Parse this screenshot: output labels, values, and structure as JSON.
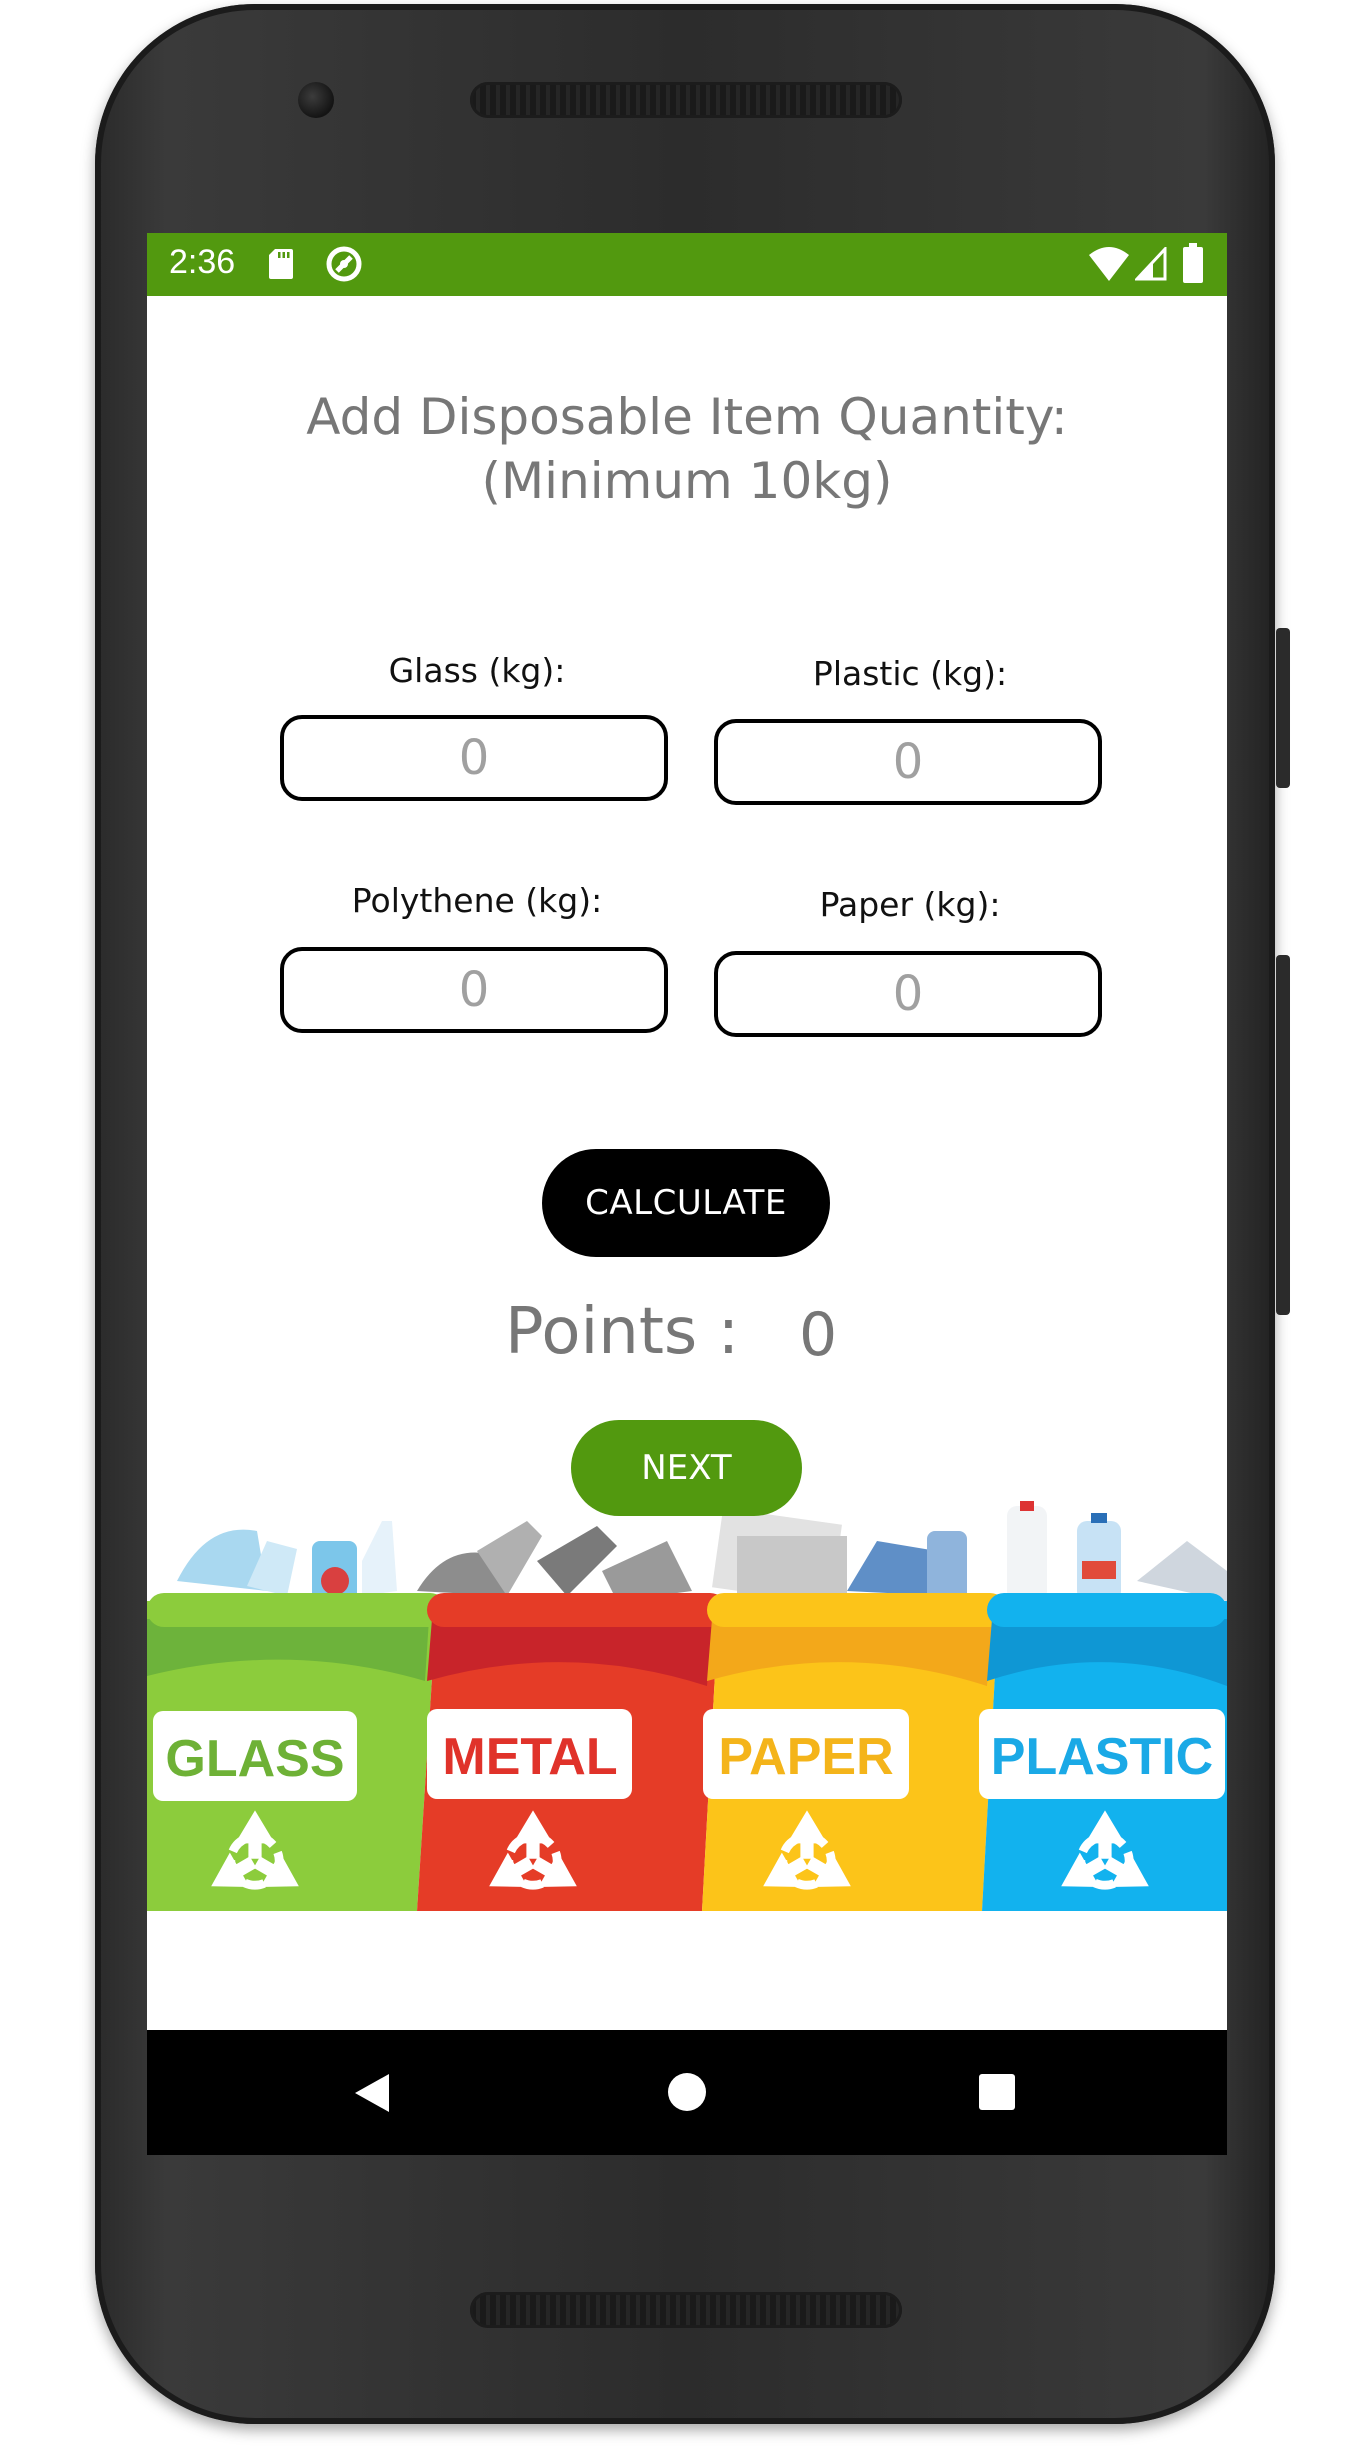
{
  "status_bar": {
    "time": "2:36",
    "icons": [
      "sd-card-icon",
      "sync-icon",
      "wifi-icon",
      "signal-icon",
      "battery-icon"
    ],
    "color": "#52990f"
  },
  "page": {
    "title_line1": "Add Disposable Item Quantity:",
    "title_line2": "(Minimum 10kg)"
  },
  "fields": {
    "glass": {
      "label": "Glass (kg):",
      "placeholder": "0"
    },
    "plastic": {
      "label": "Plastic (kg):",
      "placeholder": "0"
    },
    "polythene": {
      "label": "Polythene (kg):",
      "placeholder": "0"
    },
    "paper": {
      "label": "Paper (kg):",
      "placeholder": "0"
    }
  },
  "calculate_button": {
    "label": "CALCULATE"
  },
  "points": {
    "label": "Points :",
    "value": "0"
  },
  "next_button": {
    "label": "NEXT",
    "color": "#52990f"
  },
  "bins": [
    {
      "label": "GLASS",
      "color": "#8ccc3c",
      "text_color": "#6eb136"
    },
    {
      "label": "METAL",
      "color": "#e53c27",
      "text_color": "#e0322a"
    },
    {
      "label": "PAPER",
      "color": "#fcc419",
      "text_color": "#f4b41a"
    },
    {
      "label": "PLASTIC",
      "color": "#12b2ee",
      "text_color": "#1aa9e6"
    }
  ],
  "nav_bar": {
    "icons": [
      "back-icon",
      "home-icon",
      "recents-icon"
    ]
  }
}
